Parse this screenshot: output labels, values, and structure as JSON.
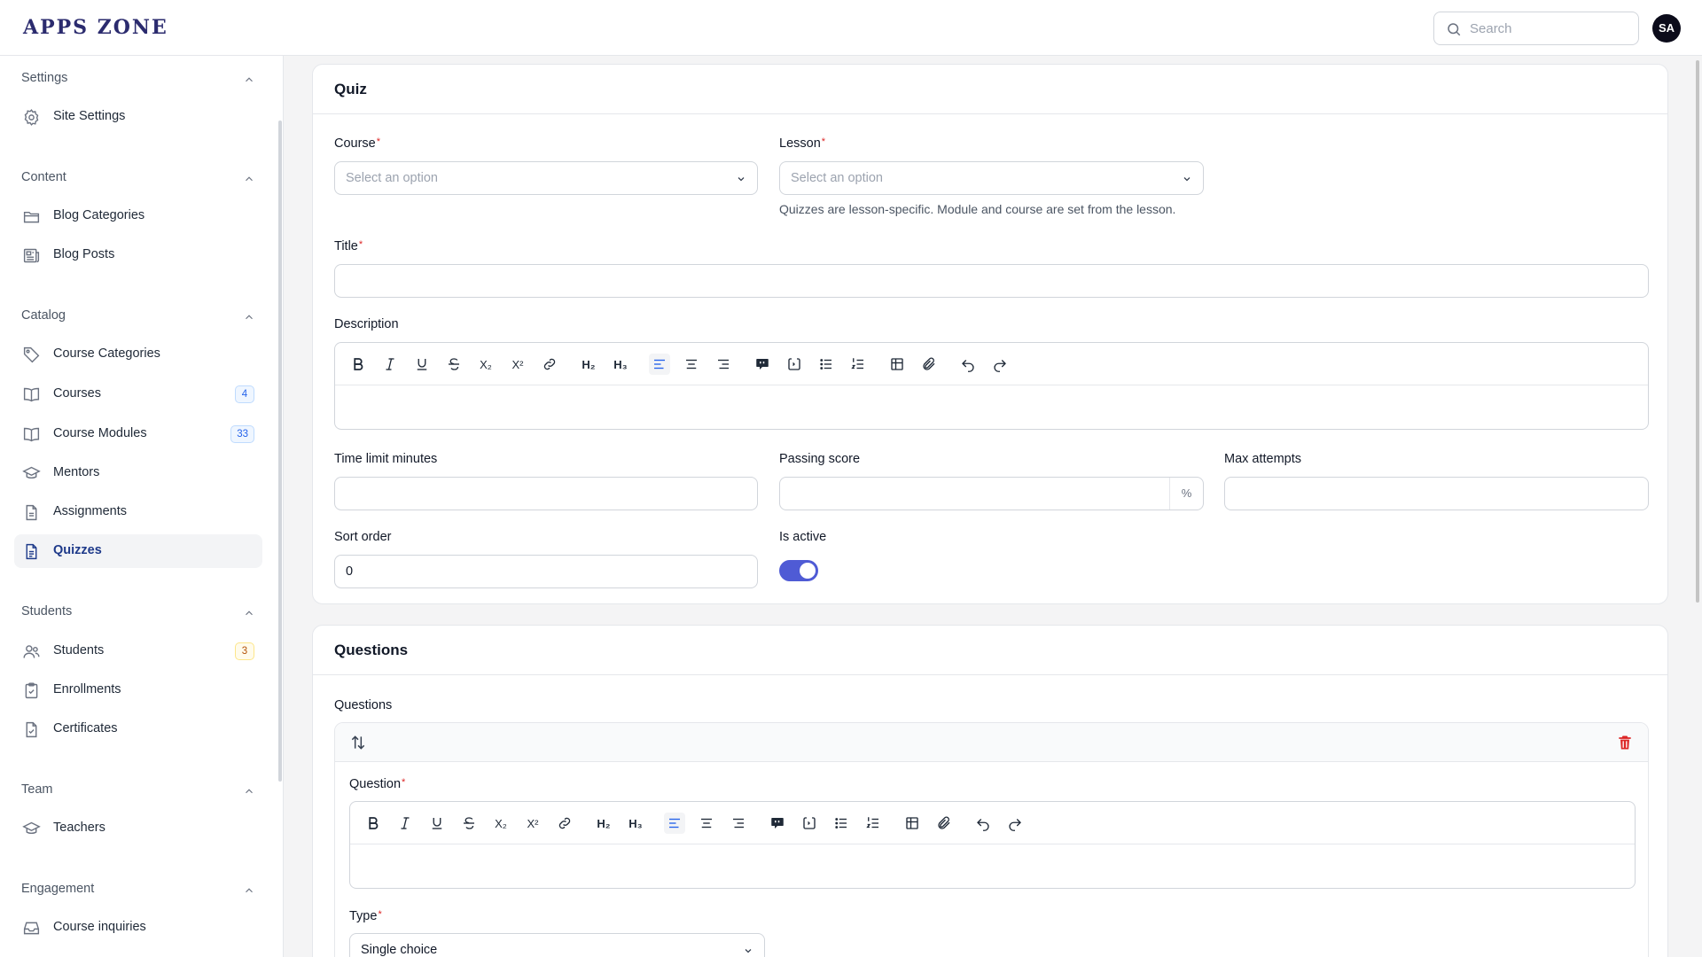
{
  "brand": {
    "logo": "APPS ZONE"
  },
  "topbar": {
    "search_placeholder": "Search",
    "avatar_initials": "SA"
  },
  "sidebar": {
    "groups": [
      {
        "label": "Settings",
        "items": [
          {
            "label": "Site Settings",
            "icon": "gear-icon"
          }
        ]
      },
      {
        "label": "Content",
        "items": [
          {
            "label": "Blog Categories",
            "icon": "folder-icon"
          },
          {
            "label": "Blog Posts",
            "icon": "newspaper-icon"
          }
        ]
      },
      {
        "label": "Catalog",
        "items": [
          {
            "label": "Course Categories",
            "icon": "tag-icon"
          },
          {
            "label": "Courses",
            "icon": "book-icon",
            "badge": "4"
          },
          {
            "label": "Course Modules",
            "icon": "book-open-icon",
            "badge": "33"
          },
          {
            "label": "Mentors",
            "icon": "academic-cap-icon"
          },
          {
            "label": "Assignments",
            "icon": "document-icon"
          },
          {
            "label": "Quizzes",
            "icon": "document-text-icon",
            "active": true
          }
        ]
      },
      {
        "label": "Students",
        "items": [
          {
            "label": "Students",
            "icon": "users-icon",
            "badge": "3"
          },
          {
            "label": "Enrollments",
            "icon": "clipboard-check-icon"
          },
          {
            "label": "Certificates",
            "icon": "document-check-icon"
          }
        ]
      },
      {
        "label": "Team",
        "items": [
          {
            "label": "Teachers",
            "icon": "academic-cap-icon"
          }
        ]
      },
      {
        "label": "Engagement",
        "items": [
          {
            "label": "Course inquiries",
            "icon": "inbox-icon"
          }
        ]
      }
    ]
  },
  "quiz_card": {
    "title": "Quiz",
    "course": {
      "label": "Course",
      "placeholder": "Select an option"
    },
    "lesson": {
      "label": "Lesson",
      "placeholder": "Select an option",
      "help": "Quizzes are lesson-specific. Module and course are set from the lesson."
    },
    "title_field": {
      "label": "Title",
      "value": ""
    },
    "description": {
      "label": "Description"
    },
    "time_limit": {
      "label": "Time limit minutes",
      "value": ""
    },
    "passing_score": {
      "label": "Passing score",
      "value": "",
      "suffix": "%"
    },
    "max_attempts": {
      "label": "Max attempts",
      "value": ""
    },
    "sort_order": {
      "label": "Sort order",
      "value": "0"
    },
    "is_active": {
      "label": "Is active",
      "value": true
    }
  },
  "questions_card": {
    "title": "Questions",
    "repeater_label": "Questions",
    "question": {
      "label": "Question"
    },
    "type": {
      "label": "Type",
      "value": "Single choice"
    }
  },
  "toolbar_buttons": [
    "bold",
    "italic",
    "underline",
    "strike",
    "subscript",
    "superscript",
    "link",
    "h2",
    "h3",
    "align-left",
    "align-center",
    "align-right",
    "blockquote",
    "code-block",
    "bullet-list",
    "ordered-list",
    "table",
    "attach",
    "undo",
    "redo"
  ],
  "toolbar_labels": {
    "subscript": "X₂",
    "superscript": "X²",
    "h2": "H₂",
    "h3": "H₃"
  },
  "colors": {
    "accent": "#4f5bd5",
    "danger": "#dc2626",
    "brand": "#2b2b6e"
  }
}
